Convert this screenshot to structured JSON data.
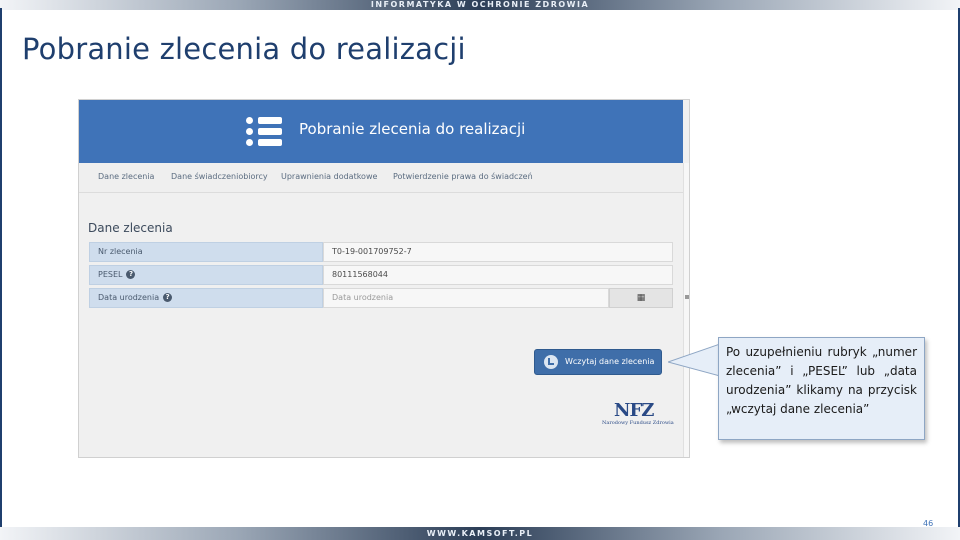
{
  "banner": {
    "top_text": "INFORMATYKA W OCHRONIE ZDROWIA",
    "bottom_text": "WWW.KAMSOFT.PL"
  },
  "slide": {
    "title": "Pobranie zlecenia do realizacji",
    "page_number": "46"
  },
  "screenshot": {
    "header_title": "Pobranie zlecenia do realizacji",
    "tabs": [
      {
        "label": "Dane zlecenia"
      },
      {
        "label": "Dane świadczeniobiorcy"
      },
      {
        "label": "Uprawnienia dodatkowe"
      },
      {
        "label": "Potwierdzenie prawa do świadczeń"
      }
    ],
    "section_title": "Dane zlecenia",
    "fields": {
      "order_number": {
        "label": "Nr zlecenia",
        "value": "T0-19-001709752-7"
      },
      "pesel": {
        "label": "PESEL",
        "value": "80111568044"
      },
      "birth_date": {
        "label": "Data urodzenia",
        "placeholder": "Data urodzenia"
      }
    },
    "load_button_label": "Wczytaj dane zlecenia",
    "logo": {
      "text": "NFZ",
      "subtitle": "Narodowy Fundusz Zdrowia"
    }
  },
  "callout": {
    "text": "Po uzupełnieniu rubryk „numer zlecenia” i „PESEL” lub „data urodzenia” klikamy na przycisk „wczytaj dane zlecenia”"
  },
  "colors": {
    "accent": "#3f73b8",
    "title": "#1f3f6e",
    "callout_bg": "#e6eef8"
  }
}
